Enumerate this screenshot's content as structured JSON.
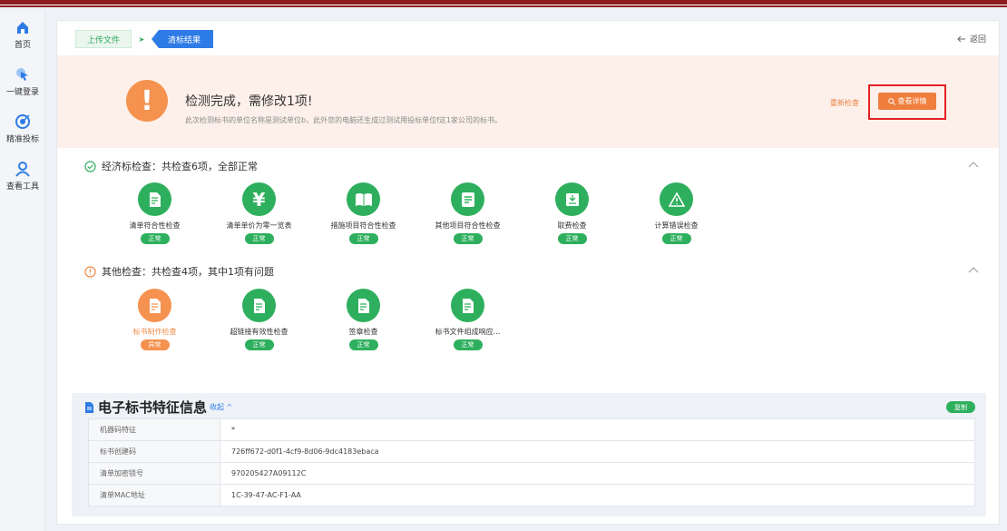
{
  "sidebar": {
    "items": [
      {
        "label": "首页",
        "icon": "home-icon"
      },
      {
        "label": "一键登录",
        "icon": "cursor-icon"
      },
      {
        "label": "精准投标",
        "icon": "target-icon"
      },
      {
        "label": "查看工具",
        "icon": "user-search-icon"
      }
    ]
  },
  "steps": {
    "upload": "上传文件",
    "result": "清标结果",
    "back": "返回"
  },
  "alert": {
    "title": "检测完成，需修改1项!",
    "subtitle": "此次检测标书的单位名称是测试单位b，此外您的电脑还生成过测试用投标单位f这1家公司的标书。",
    "recheck": "重新检查",
    "detail": "查看详情"
  },
  "economic": {
    "title": "经济标检查：共检查6项，全部正常",
    "items": [
      {
        "name": "清单符合性检查",
        "status": "正常",
        "icon": "document-icon"
      },
      {
        "name": "清单单价为零一览表",
        "status": "正常",
        "icon": "yen-icon"
      },
      {
        "name": "措施项目符合性检查",
        "status": "正常",
        "icon": "book-icon"
      },
      {
        "name": "其他项目符合性检查",
        "status": "正常",
        "icon": "list-icon"
      },
      {
        "name": "取费检查",
        "status": "正常",
        "icon": "archive-icon"
      },
      {
        "name": "计算错误检查",
        "status": "正常",
        "icon": "warning-icon"
      }
    ]
  },
  "other": {
    "title": "其他检查：共检查4项，其中1项有问题",
    "items": [
      {
        "name": "标书制作检查",
        "status": "异常",
        "icon": "document-icon"
      },
      {
        "name": "超链接有效性检查",
        "status": "正常",
        "icon": "document-icon"
      },
      {
        "name": "签章检查",
        "status": "正常",
        "icon": "document-icon"
      },
      {
        "name": "标书文件组成响应...",
        "status": "正常",
        "icon": "document-icon"
      }
    ]
  },
  "info": {
    "title": "电子标书特征信息",
    "collapse": "收起",
    "copy": "复制",
    "rows": [
      {
        "key": "机器码特征",
        "value": "*"
      },
      {
        "key": "标书创建码",
        "value": "726ff672-d0f1-4cf9-8d06-9dc4183ebaca"
      },
      {
        "key": "清单加密锁号",
        "value": "970205427A09112C"
      },
      {
        "key": "清单MAC地址",
        "value": "1C-39-47-AC-F1-AA"
      }
    ]
  },
  "colors": {
    "accent_green": "#2eaf5d",
    "accent_orange": "#f5924f",
    "accent_blue": "#2d7be5",
    "highlight_red": "#e32222"
  }
}
